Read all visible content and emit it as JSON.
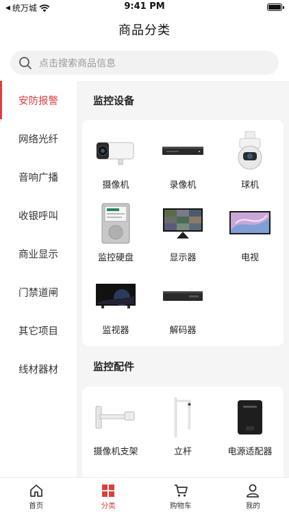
{
  "status_bar": {
    "carrier_back": "◀",
    "carrier": "统万城",
    "time": "9:41 PM"
  },
  "header": {
    "title": "商品分类"
  },
  "search": {
    "placeholder": "点击搜索商品信息"
  },
  "sidebar": {
    "items": [
      {
        "label": "安防报警",
        "active": true
      },
      {
        "label": "网络光纤"
      },
      {
        "label": "音响广播"
      },
      {
        "label": "收银呼叫"
      },
      {
        "label": "商业显示"
      },
      {
        "label": "门禁道闸"
      },
      {
        "label": "其它项目"
      },
      {
        "label": "线材器材"
      }
    ]
  },
  "sections": [
    {
      "title": "监控设备",
      "items": [
        {
          "label": "摄像机",
          "icon": "bullet-camera-icon"
        },
        {
          "label": "录像机",
          "icon": "nvr-recorder-icon"
        },
        {
          "label": "球机",
          "icon": "dome-camera-icon"
        },
        {
          "label": "监控硬盘",
          "icon": "hard-disk-icon"
        },
        {
          "label": "显示器",
          "icon": "monitor-icon"
        },
        {
          "label": "电视",
          "icon": "tv-icon"
        },
        {
          "label": "监视器",
          "icon": "surveillance-monitor-icon"
        },
        {
          "label": "解码器",
          "icon": "decoder-icon"
        }
      ]
    },
    {
      "title": "监控配件",
      "items": [
        {
          "label": "摄像机支架",
          "icon": "camera-bracket-icon"
        },
        {
          "label": "立杆",
          "icon": "pole-icon"
        },
        {
          "label": "电源适配器",
          "icon": "power-adapter-icon"
        }
      ]
    }
  ],
  "tab_bar": {
    "items": [
      {
        "label": "首页",
        "icon": "home-icon"
      },
      {
        "label": "分类",
        "icon": "category-icon",
        "active": true
      },
      {
        "label": "购物车",
        "icon": "cart-icon"
      },
      {
        "label": "我的",
        "icon": "profile-icon"
      }
    ]
  },
  "colors": {
    "accent": "#e23c3c",
    "background": "#f5f5f5"
  }
}
